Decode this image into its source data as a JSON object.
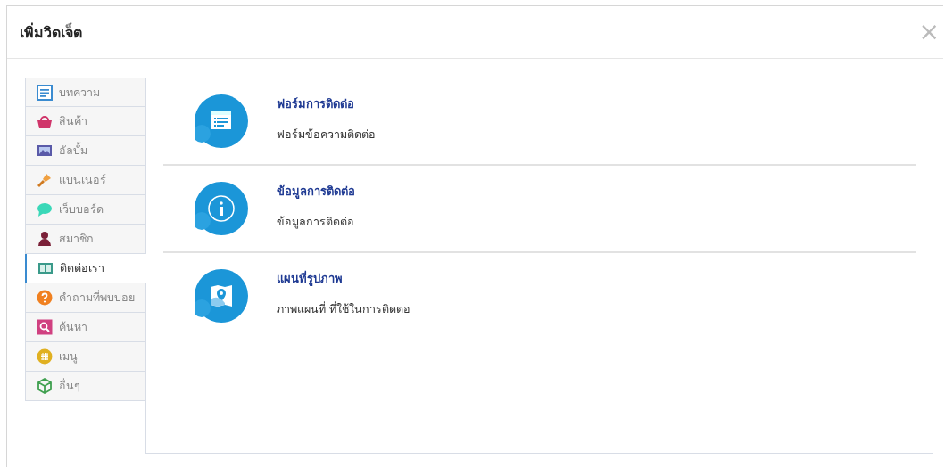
{
  "dialog": {
    "title": "เพิ่มวิดเจ็ต",
    "close": "×"
  },
  "sidebar": {
    "items": [
      {
        "label": "บทความ",
        "kind": "article",
        "selected": false
      },
      {
        "label": "สินค้า",
        "kind": "product",
        "selected": false
      },
      {
        "label": "อัลบั้ม",
        "kind": "album",
        "selected": false
      },
      {
        "label": "แบนเนอร์",
        "kind": "banner",
        "selected": false
      },
      {
        "label": "เว็บบอร์ด",
        "kind": "board",
        "selected": false
      },
      {
        "label": "สมาชิก",
        "kind": "member",
        "selected": false
      },
      {
        "label": "ติดต่อเรา",
        "kind": "contact",
        "selected": true
      },
      {
        "label": "คำถามที่พบบ่อย",
        "kind": "faq",
        "selected": false
      },
      {
        "label": "ค้นหา",
        "kind": "search",
        "selected": false
      },
      {
        "label": "เมนู",
        "kind": "menu",
        "selected": false
      },
      {
        "label": "อื่นๆ",
        "kind": "other",
        "selected": false
      }
    ]
  },
  "widgets": [
    {
      "title": "ฟอร์มการติดต่อ",
      "description": "ฟอร์มข้อความติดต่อ",
      "kind": "form"
    },
    {
      "title": "ข้อมูลการติดต่อ",
      "description": "ข้อมูลการติดต่อ",
      "kind": "info"
    },
    {
      "title": "แผนที่รูปภาพ",
      "description": "ภาพแผนที่ ที่ใช้ในการติดต่อ",
      "kind": "map"
    }
  ]
}
